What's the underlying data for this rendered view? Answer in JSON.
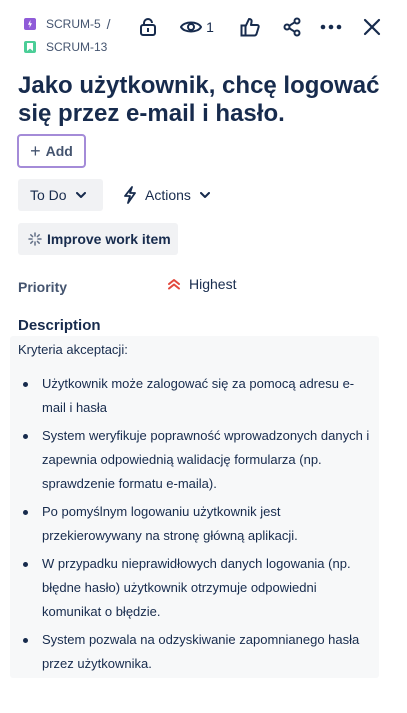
{
  "breadcrumb": {
    "parent": {
      "key": "SCRUM-5",
      "icon": "epic-icon",
      "color": "#8f5bd8"
    },
    "separator": "/",
    "current": {
      "key": "SCRUM-13",
      "icon": "story-icon",
      "color": "#4bce97"
    }
  },
  "toolbar": {
    "lock_icon": "lock-icon",
    "watch_icon": "eye-icon",
    "watch_count": "1",
    "like_icon": "thumbs-up-icon",
    "share_icon": "share-icon",
    "more_icon": "more-icon",
    "close_icon": "close-icon"
  },
  "issue": {
    "title": "Jako użytkownik, chcę logować się przez e-mail i hasło."
  },
  "add_button": {
    "label": "Add",
    "border_color": "#a48bd8"
  },
  "status": {
    "label": "To Do"
  },
  "actions": {
    "label": "Actions"
  },
  "improve": {
    "label": "Improve work item"
  },
  "priority": {
    "label": "Priority",
    "value": "Highest",
    "color": "#e2483d"
  },
  "description": {
    "heading": "Description",
    "intro": "Kryteria akceptacji:",
    "items": [
      "Użytkownik może zalogować się za pomocą adresu e-mail i hasła",
      "System weryfikuje poprawność wprowadzonych danych i zapewnia odpowiednią walidację formularza (np. sprawdzenie formatu e-maila).",
      "Po pomyślnym logowaniu użytkownik jest przekierowywany na stronę główną aplikacji.",
      "W przypadku nieprawidłowych danych logowania (np. błędne hasło) użytkownik otrzymuje odpowiedni komunikat o błędzie.",
      "System pozwala na odzyskiwanie zapomnianego hasła przez użytkownika."
    ]
  }
}
